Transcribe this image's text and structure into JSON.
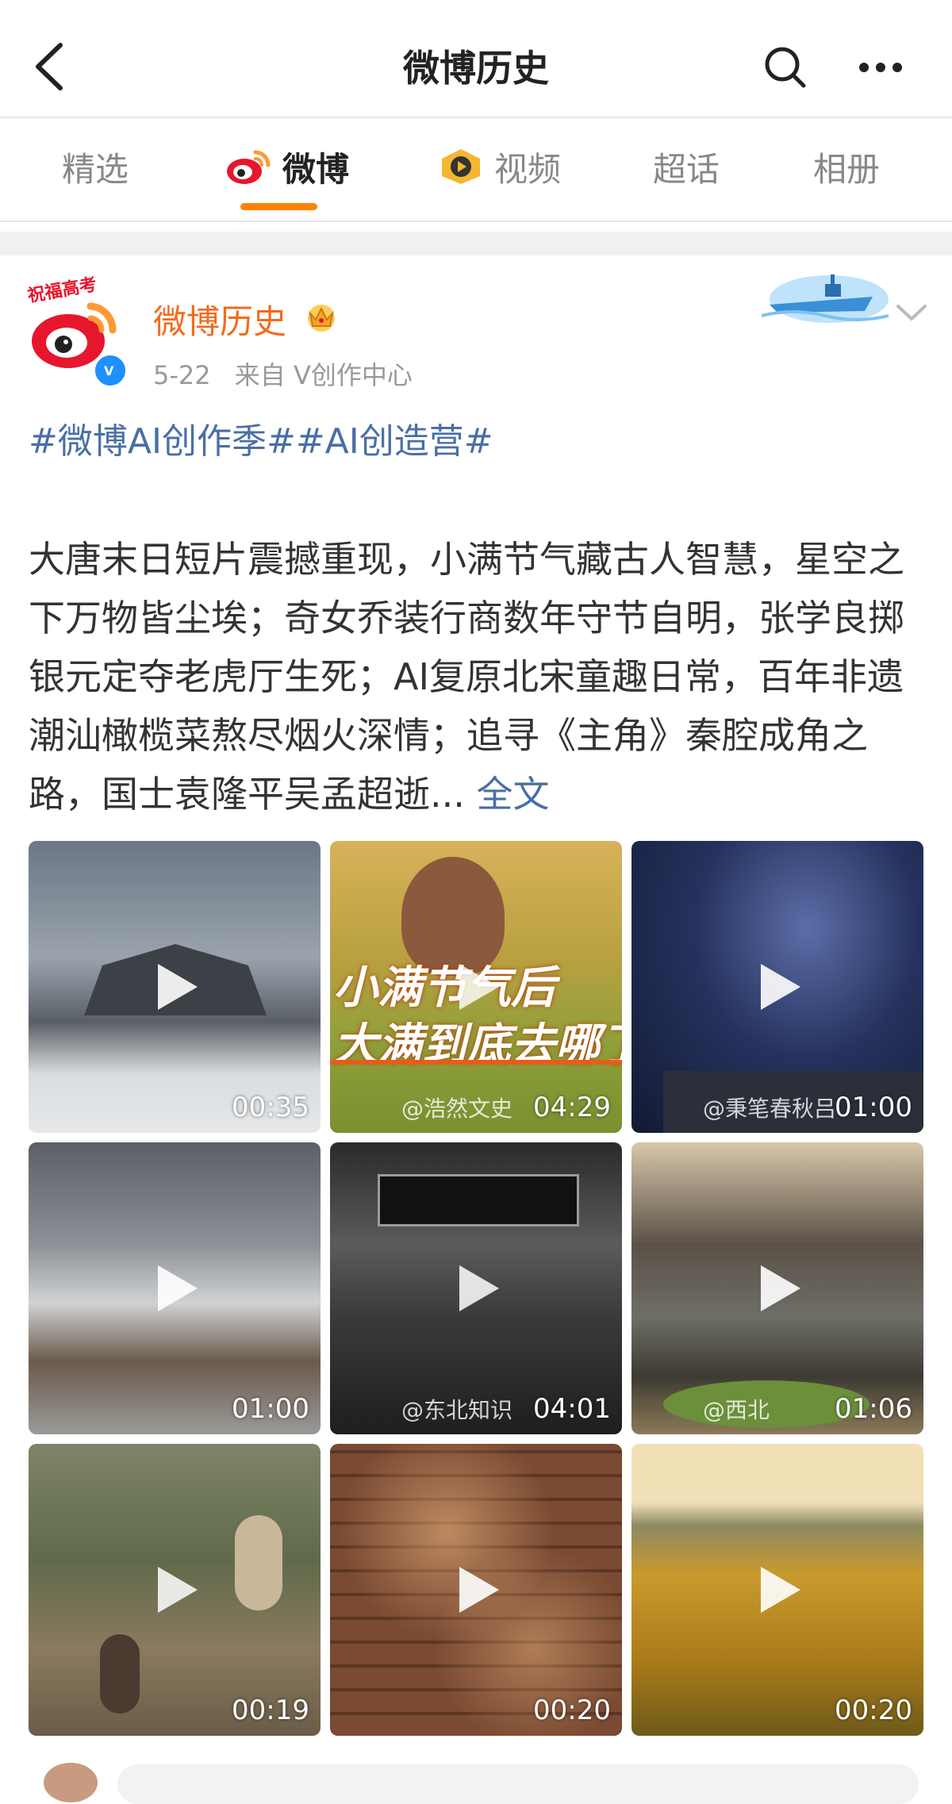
{
  "header": {
    "title": "微博历史",
    "back_icon": "chevron-left-icon",
    "search_icon": "search-icon",
    "more_icon": "more-icon"
  },
  "tabs": [
    {
      "label": "精选",
      "active": false
    },
    {
      "label": "微博",
      "active": true,
      "icon": "weibo-logo-icon"
    },
    {
      "label": "视频",
      "active": false,
      "icon": "video-play-icon"
    },
    {
      "label": "超话",
      "active": false
    },
    {
      "label": "相册",
      "active": false
    }
  ],
  "colors": {
    "accent": "#ff8200",
    "username": "#f26b1d",
    "link": "#4a6fa5"
  },
  "post": {
    "author": "微博历史",
    "avatar_badge_text": "祝福高考",
    "date": "5-22",
    "source": "来自 V创作中心",
    "tags": [
      "#微博AI创作季#",
      "#AI创造营#"
    ],
    "text": "大唐末日短片震撼重现，小满节气藏古人智慧，星空之下万物皆尘埃；奇女乔装行商数年守节自明，张学良掷银元定夺老虎厅生死；AI复原北宋童趣日常，百年非遗潮汕橄榄菜熬尽烟火深情；追寻《主角》秦腔成角之路，国士袁隆平吴孟超逝...",
    "more_label": "全文",
    "videos": [
      {
        "duration": "00:35",
        "watermark": ""
      },
      {
        "duration": "04:29",
        "watermark": "@浩然文史",
        "caption1": "小满节气后",
        "caption2": "大满到底去哪了"
      },
      {
        "duration": "01:00",
        "watermark": "@秉笔春秋吕"
      },
      {
        "duration": "01:00",
        "watermark": ""
      },
      {
        "duration": "04:01",
        "watermark": "@东北知识"
      },
      {
        "duration": "01:06",
        "watermark": "@西北"
      },
      {
        "duration": "00:19",
        "watermark": ""
      },
      {
        "duration": "00:20",
        "watermark": ""
      },
      {
        "duration": "00:20",
        "watermark": ""
      }
    ]
  }
}
